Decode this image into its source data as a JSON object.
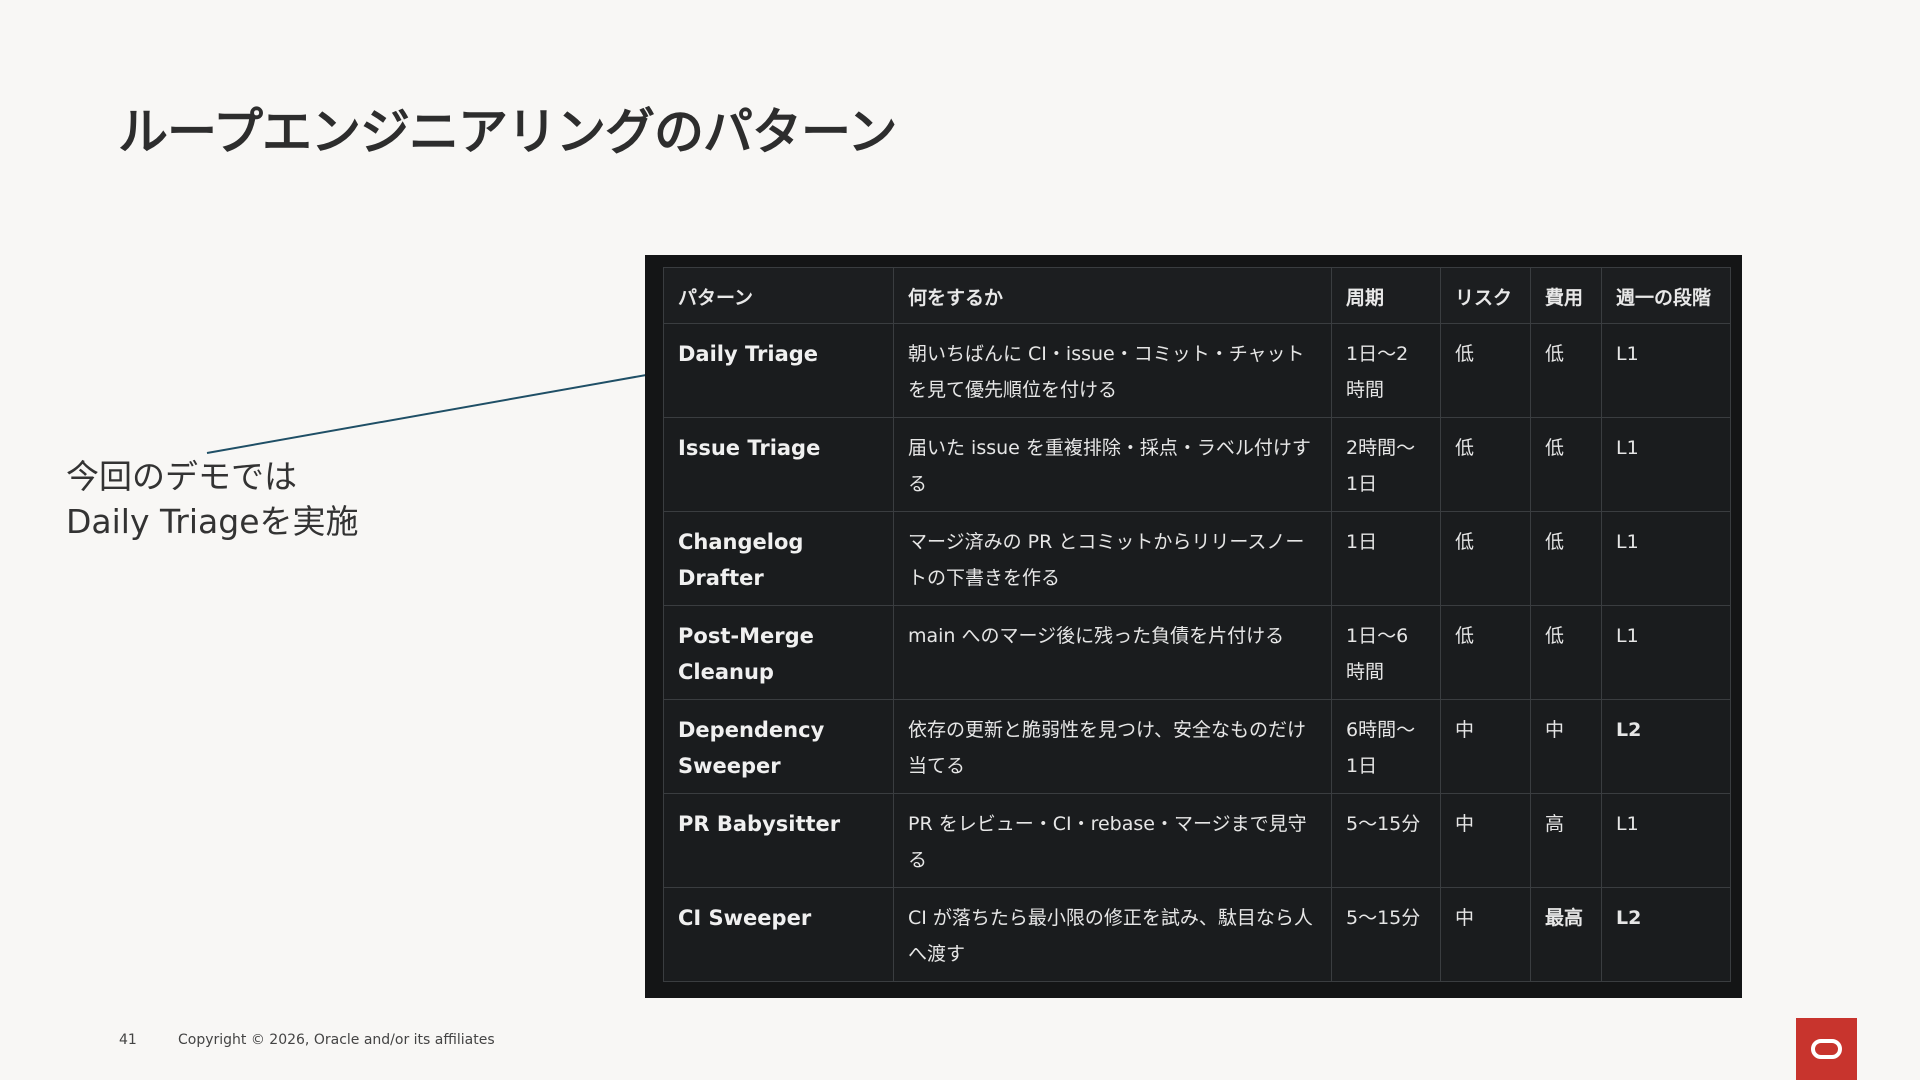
{
  "slide": {
    "title": "ループエンジニアリングのパターン",
    "callout_line1": "今回のデモでは",
    "callout_line2": "Daily Triageを実施",
    "page_number": "41",
    "copyright": "Copyright © 2026, Oracle and/or its affiliates"
  },
  "table": {
    "headers": [
      "パターン",
      "何をするか",
      "周期",
      "リスク",
      "費用",
      "週一の段階"
    ],
    "rows": [
      {
        "pattern": "Daily Triage",
        "description": "朝いちばんに CI・issue・コミット・チャットを見て優先順位を付ける",
        "cycle": "1日〜2時間",
        "risk": "低",
        "cost": "低",
        "stage": "L1"
      },
      {
        "pattern": "Issue Triage",
        "description": "届いた issue を重複排除・採点・ラベル付けする",
        "cycle": "2時間〜1日",
        "risk": "低",
        "cost": "低",
        "stage": "L1"
      },
      {
        "pattern": "Changelog Drafter",
        "description": "マージ済みの PR とコミットからリリースノートの下書きを作る",
        "cycle": "1日",
        "risk": "低",
        "cost": "低",
        "stage": "L1"
      },
      {
        "pattern": "Post-Merge Cleanup",
        "description": "main へのマージ後に残った負債を片付ける",
        "cycle": "1日〜6時間",
        "risk": "低",
        "cost": "低",
        "stage": "L1"
      },
      {
        "pattern": "Dependency Sweeper",
        "description": "依存の更新と脆弱性を見つけ、安全なものだけ当てる",
        "cycle": "6時間〜1日",
        "risk": "中",
        "cost": "中",
        "stage": "L2"
      },
      {
        "pattern": "PR Babysitter",
        "description": "PR をレビュー・CI・rebase・マージまで見守る",
        "cycle": "5〜15分",
        "risk": "中",
        "cost": "高",
        "stage": "L1"
      },
      {
        "pattern": "CI Sweeper",
        "description": "CI が落ちたら最小限の修正を試み、駄目なら人へ渡す",
        "cycle": "5〜15分",
        "risk": "中",
        "cost": "最高",
        "stage": "L2"
      }
    ]
  },
  "colors": {
    "background": "#f8f7f5",
    "table_bg": "#141516",
    "arrow": "#1f4f66",
    "logo": "#c8342d"
  }
}
